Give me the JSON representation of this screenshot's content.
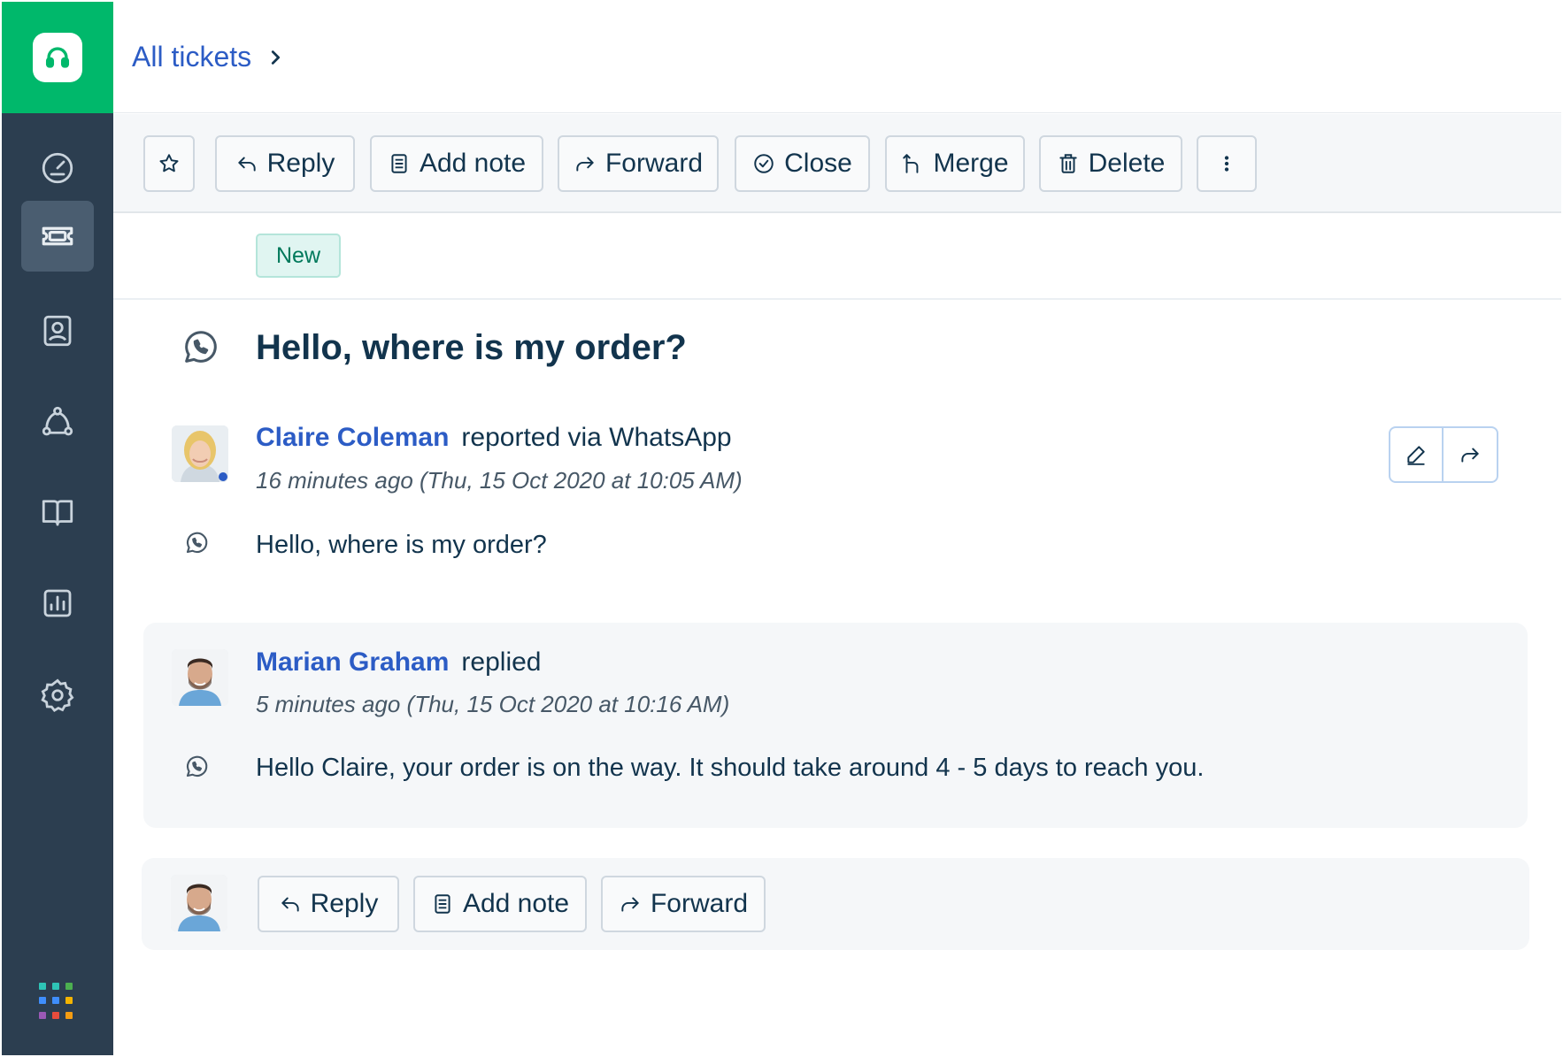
{
  "breadcrumb": {
    "label": "All tickets"
  },
  "toolbar": {
    "reply": "Reply",
    "add_note": "Add note",
    "forward": "Forward",
    "close": "Close",
    "merge": "Merge",
    "delete": "Delete"
  },
  "ticket": {
    "status": "New",
    "subject": "Hello, where is my order?",
    "channel_icon": "whatsapp-icon"
  },
  "conversation": [
    {
      "author": "Claire Coleman",
      "action": "reported via WhatsApp",
      "timestamp": "16 minutes ago (Thu, 15 Oct 2020 at 10:05 AM)",
      "message": "Hello, where is my order?"
    },
    {
      "author": "Marian Graham",
      "action": "replied",
      "timestamp": "5 minutes ago (Thu, 15 Oct 2020 at 10:16 AM)",
      "message": "Hello Claire, your order is on the way. It should take around 4 - 5 days to reach you."
    }
  ],
  "compose": {
    "reply": "Reply",
    "add_note": "Add note",
    "forward": "Forward"
  },
  "sidebar": {
    "items": [
      "dashboard-icon",
      "tickets-icon",
      "contacts-icon",
      "social-icon",
      "solutions-icon",
      "analytics-icon",
      "settings-icon"
    ],
    "active": "tickets-icon"
  },
  "colors": {
    "brand_green": "#00b86b",
    "sidebar_bg": "#2c3e50",
    "link_blue": "#2c5cc5",
    "status_new": "#00795b"
  }
}
